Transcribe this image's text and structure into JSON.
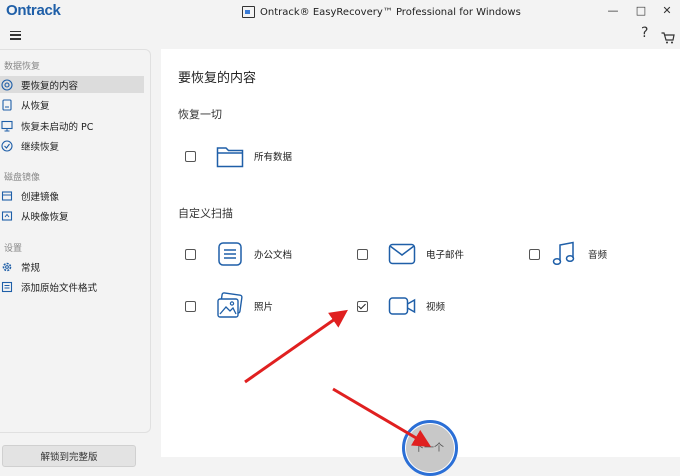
{
  "window": {
    "logo": "Ontrack",
    "title": "Ontrack® EasyRecovery™ Professional for Windows",
    "minimize": "—",
    "maximize": "□",
    "close": "✕",
    "help": "?"
  },
  "sidebar": {
    "sections": [
      {
        "header": "数据恢复",
        "items": [
          {
            "label": "要恢复的内容",
            "icon": "target-icon",
            "active": true
          },
          {
            "label": "从恢复",
            "icon": "drive-icon"
          },
          {
            "label": "恢复未启动的 PC",
            "icon": "monitor-icon"
          },
          {
            "label": "继续恢复",
            "icon": "resume-icon"
          }
        ]
      },
      {
        "header": "磁盘镜像",
        "items": [
          {
            "label": "创建镜像",
            "icon": "disk-image-icon"
          },
          {
            "label": "从映像恢复",
            "icon": "image-restore-icon"
          }
        ]
      },
      {
        "header": "设置",
        "items": [
          {
            "label": "常规",
            "icon": "gear-icon"
          },
          {
            "label": "添加原始文件格式",
            "icon": "file-format-icon"
          }
        ]
      }
    ],
    "upgrade_label": "解锁到完整版"
  },
  "main": {
    "title": "要恢复的内容",
    "restore_all": {
      "heading": "恢复一切",
      "option": {
        "label": "所有数据",
        "checked": false,
        "icon": "folder-icon"
      }
    },
    "custom_scan": {
      "heading": "自定义扫描",
      "options": [
        {
          "label": "办公文档",
          "checked": false,
          "icon": "document-icon"
        },
        {
          "label": "电子邮件",
          "checked": false,
          "icon": "email-icon"
        },
        {
          "label": "音频",
          "checked": false,
          "icon": "music-icon"
        },
        {
          "label": "照片",
          "checked": false,
          "icon": "photo-icon"
        },
        {
          "label": "视频",
          "checked": true,
          "icon": "video-icon"
        }
      ]
    },
    "next_label": "下一个"
  },
  "colors": {
    "accent": "#2b6fd6",
    "annotation": "#e02020",
    "logo": "#1f5fa8"
  }
}
